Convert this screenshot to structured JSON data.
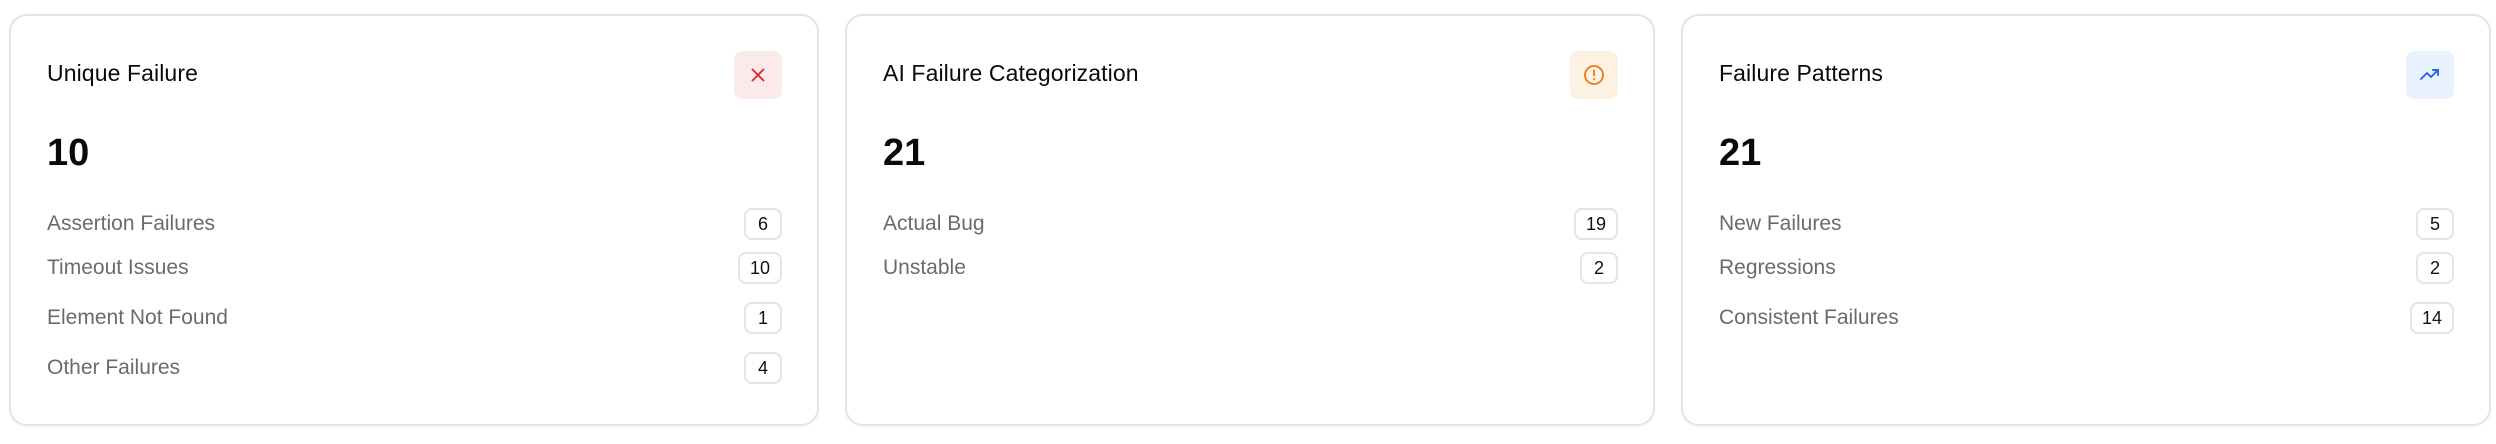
{
  "cards": [
    {
      "title": "Unique Failure",
      "icon": "close-icon",
      "icon_color": "#dc2626",
      "icon_bg": "#fbeaea",
      "total": "10",
      "items": [
        {
          "label": "Assertion Failures",
          "count": "6"
        },
        {
          "label": "Timeout Issues",
          "count": "10"
        },
        {
          "label": "Element Not Found",
          "count": "1"
        },
        {
          "label": "Other Failures",
          "count": "4"
        }
      ]
    },
    {
      "title": "AI Failure Categorization",
      "icon": "alert-circle-icon",
      "icon_color": "#ea7a16",
      "icon_bg": "#fdf1e2",
      "total": "21",
      "items": [
        {
          "label": "Actual Bug",
          "count": "19"
        },
        {
          "label": "Unstable",
          "count": "2"
        }
      ]
    },
    {
      "title": "Failure Patterns",
      "icon": "trending-up-icon",
      "icon_color": "#2563eb",
      "icon_bg": "#e8f1fc",
      "total": "21",
      "items": [
        {
          "label": "New Failures",
          "count": "5"
        },
        {
          "label": "Regressions",
          "count": "2"
        },
        {
          "label": "Consistent Failures",
          "count": "14"
        }
      ]
    }
  ]
}
